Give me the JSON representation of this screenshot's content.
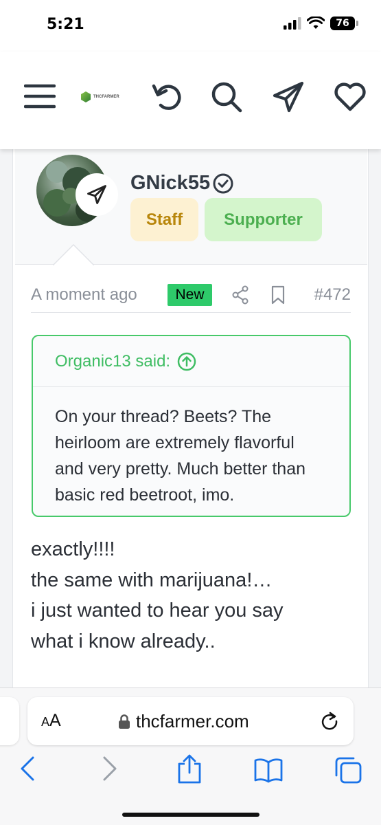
{
  "status_bar": {
    "time": "5:21",
    "battery": "76"
  },
  "header": {
    "logo_text": "THCFARMER"
  },
  "user": {
    "name": "GNick55",
    "badges": [
      "Staff",
      "Supporter"
    ]
  },
  "post_meta": {
    "time": "A moment ago",
    "new_label": "New",
    "post_number": "#472"
  },
  "quote": {
    "author_line": "Organic13 said:",
    "text": "On your thread? Beets? The heirloom are extremely flavorful and very pretty. Much better than basic red beetroot, imo."
  },
  "post": {
    "lines": [
      "exactly!!!!",
      "the same with marijuana!…",
      "i just wanted to hear you say",
      "what i know already.."
    ]
  },
  "safari": {
    "aa_label_small": "A",
    "aa_label_big": "A",
    "url": "thcfarmer.com"
  },
  "colors": {
    "accent_green": "#47c96a",
    "new_badge": "#2eca6a",
    "staff_bg": "#fdf1d2",
    "supporter_bg": "#d4f5cc",
    "link_blue": "#1a73e8"
  }
}
